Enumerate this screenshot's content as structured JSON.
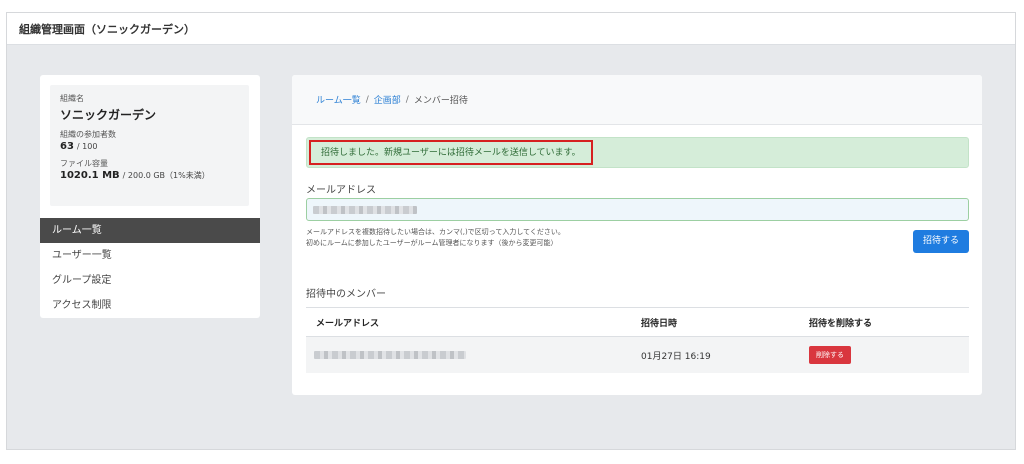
{
  "header": {
    "title": "組織管理画面（ソニックガーデン）"
  },
  "org": {
    "name_label": "組織名",
    "name": "ソニックガーデン",
    "members_label": "組織の参加者数",
    "members_count": "63",
    "members_total": "/ 100",
    "storage_label": "ファイル容量",
    "storage_used": "1020.1 MB",
    "storage_total": "/ 200.0 GB（1%未満）"
  },
  "sidebar": {
    "items": [
      {
        "label": "ルーム一覧",
        "active": true
      },
      {
        "label": "ユーザー一覧",
        "active": false
      },
      {
        "label": "グループ設定",
        "active": false
      },
      {
        "label": "アクセス制限",
        "active": false
      }
    ]
  },
  "breadcrumb": {
    "rooms": "ルーム一覧",
    "sep": "/",
    "department": "企画部",
    "current": "メンバー招待"
  },
  "alert": {
    "message": "招待しました。新規ユーザーには招待メールを送信しています。"
  },
  "form": {
    "email_label": "メールアドレス",
    "help_line1": "メールアドレスを複数招待したい場合は、カンマ(,)で区切って入力してください。",
    "help_line2": "初めにルームに参加したユーザーがルーム管理者になります（後から変更可能）",
    "invite_button": "招待する"
  },
  "pending": {
    "title": "招待中のメンバー",
    "columns": [
      "メールアドレス",
      "招待日時",
      "招待を削除する"
    ],
    "rows": [
      {
        "invited_at": "01月27日 16:19",
        "delete_label": "削除する"
      }
    ]
  },
  "colors": {
    "primary": "#1f7ce0",
    "danger": "#d9363e",
    "success_bg": "#d5edd9",
    "nav_active": "#4a4a4a"
  }
}
